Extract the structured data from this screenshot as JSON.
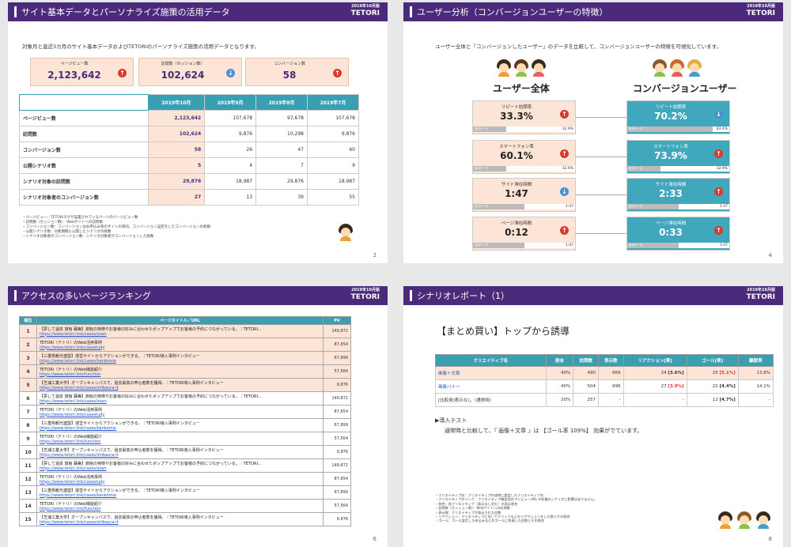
{
  "s1": {
    "title": "サイト基本データとパーソナライズ施策の活用データ",
    "date": "2019年10月版",
    "logo": "TETORI",
    "page": "2",
    "intro": "対象月と直近3カ月のサイト基本データおよびTETORIのパーソナライズ施策の活用データとなります。",
    "kpis": [
      {
        "label": "ページビュー数",
        "value": "2,123,642",
        "dir": "up"
      },
      {
        "label": "訪問数（セッション数）",
        "value": "102,624",
        "dir": "down"
      },
      {
        "label": "コンバージョン数",
        "value": "58",
        "dir": "up"
      }
    ],
    "cols": [
      "",
      "2019年10月",
      "2019年9月",
      "2019年8月",
      "2019年7月"
    ],
    "rows": [
      [
        "ページビュー数",
        "2,123,642",
        "107,678",
        "97,678",
        "107,678"
      ],
      [
        "訪問数",
        "102,624",
        "9,876",
        "10,298",
        "9,876"
      ],
      [
        "コンバージョン数",
        "58",
        "26",
        "47",
        "60"
      ],
      [
        "公開シナリオ数",
        "5",
        "4",
        "7",
        "9"
      ],
      [
        "シナリオ対象の訪問数",
        "29,876",
        "18,987",
        "29,876",
        "18,987"
      ],
      [
        "シナリオ対象者のコンバージョン数",
        "27",
        "13",
        "39",
        "55"
      ]
    ],
    "notes": [
      "・ページビュー：TETORIタグが設置されているページのページビュー数",
      "・訪問数（セッション数）：Webサイトへの訪問数",
      "・コンバージョン数：コンバージョンはお申込み等のサイトの目的。コンバージョン設定をしたコンバージョンの総数",
      "・公開シナリオ数：対象期間に公開したシナリオの総数",
      "・シナリオ対象者のコンバージョン数：シナリオ対象者がコンバージョンした総数"
    ]
  },
  "s2": {
    "title": "ユーザー分析（コンバージョンユーザーの特徴）",
    "date": "2019年10月版",
    "logo": "TETORI",
    "page": "4",
    "intro": "ユーザー全体と「コンバージョンしたユーザー」のデータを比較して、コンバージョンユーザーの特徴を可視化しています。",
    "left_title": "ユーザー全体",
    "right_title": "コンバージョンユーザー",
    "bar_label": "前月データ",
    "metrics": [
      {
        "label": "リピート訪問率",
        "left": "33.3%",
        "ldir": "up",
        "lprev": "32.9%",
        "lfill": 0.329,
        "right": "70.2%",
        "rdir": "down",
        "rprev": "83.4%",
        "rfill": 0.834
      },
      {
        "label": "スマートフォン率",
        "left": "60.1%",
        "ldir": "up",
        "lprev": "32.9%",
        "lfill": 0.329,
        "right": "73.9%",
        "rdir": "up",
        "rprev": "32.9%",
        "rfill": 0.329
      },
      {
        "label": "サイト滞在時間",
        "left": "1:47",
        "ldir": "down",
        "lprev": "1:47",
        "lfill": 0.5,
        "right": "2:33",
        "rdir": "up",
        "rprev": "1:47",
        "rfill": 0.5
      },
      {
        "label": "ページ滞在時間",
        "left": "0:12",
        "ldir": "up",
        "lprev": "1:47",
        "lfill": 0.5,
        "right": "0:33",
        "rdir": "up",
        "rprev": "1:47",
        "rfill": 0.5
      }
    ]
  },
  "s3": {
    "title": "アクセスの多いページランキング",
    "date": "2019年10月版",
    "logo": "TETORI",
    "page": "6",
    "cols": [
      "順位",
      "ページタイトル／URL",
      "PV"
    ],
    "rows": [
      {
        "rank": "1",
        "title": "【夢して温泉 旅館 蘇庵】旅館の特徴やお客様の好みに合わせたポップアップでお客様の予約につながっている。｜TETORI…",
        "url": "https://www.tetori.link/cases/soan",
        "pv": "149,872"
      },
      {
        "rank": "2",
        "title": "TETORI（テトリ）のWeb活用事例",
        "url": "https://www.tetori.link/casestudy",
        "pv": "87,654"
      },
      {
        "rank": "3",
        "title": "【三重県観光連盟】運営サイトからアクションができる。｜TETORI導入事例インタビュー",
        "url": "https://www.tetori.link/cases/kankomie",
        "pv": "67,899"
      },
      {
        "rank": "4",
        "title": "TETORI（テトリ）のWeb機能紹介",
        "url": "https://www.tetori.link/function",
        "pv": "57,564"
      },
      {
        "rank": "5",
        "title": "【芝浦工業大学】オープンキャンパスで、過去最高の申込者数を獲得。｜TETORI導入事例インタビュー",
        "url": "https://www.tetori.link/cases/shibaura-it",
        "pv": "9,876"
      },
      {
        "rank": "6",
        "title": "【夢して温泉 旅館 蘇庵】旅館の特徴やお客様の好みに合わせたポップアップでお客様の予約につながっている。｜TETORI…",
        "url": "https://www.tetori.link/cases/soan",
        "pv": "149,872"
      },
      {
        "rank": "7",
        "title": "TETORI（テトリ）のWeb活用事例",
        "url": "https://www.tetori.link/casestudy",
        "pv": "87,654"
      },
      {
        "rank": "8",
        "title": "【三重県観光連盟】運営サイトからアクションができる。｜TETORI導入事例インタビュー",
        "url": "https://www.tetori.link/cases/kankomie",
        "pv": "67,899"
      },
      {
        "rank": "9",
        "title": "TETORI（テトリ）のWeb機能紹介",
        "url": "https://www.tetori.link/function",
        "pv": "57,564"
      },
      {
        "rank": "10",
        "title": "【芝浦工業大学】オープンキャンパスで、過去最高の申込者数を獲得。｜TETORI導入事例インタビュー",
        "url": "https://www.tetori.link/cases/shibaura-it",
        "pv": "9,876"
      },
      {
        "rank": "11",
        "title": "【夢して温泉 旅館 蘇庵】旅館の特徴やお客様の好みに合わせたポップアップでお客様の予約につながっている。｜TETORI…",
        "url": "https://www.tetori.link/cases/soan",
        "pv": "149,872"
      },
      {
        "rank": "12",
        "title": "TETORI（テトリ）のWeb活用事例",
        "url": "https://www.tetori.link/casestudy",
        "pv": "87,654"
      },
      {
        "rank": "13",
        "title": "【三重県観光連盟】運営サイトからアクションができる。｜TETORI導入事例インタビュー",
        "url": "https://www.tetori.link/cases/kankomie",
        "pv": "67,899"
      },
      {
        "rank": "14",
        "title": "TETORI（テトリ）のWeb機能紹介",
        "url": "https://www.tetori.link/function",
        "pv": "57,564"
      },
      {
        "rank": "15",
        "title": "【芝浦工業大学】オープンキャンパスで、過去最高の申込者数を獲得。｜TETORI導入事例インタビュー",
        "url": "https://www.tetori.link/cases/shibaura-it",
        "pv": "9,876"
      }
    ]
  },
  "s4": {
    "title": "シナリオレポート（1）",
    "date": "2019年10月版",
    "logo": "TETORI",
    "page": "8",
    "heading": "【まとめ買い】トップから誘導",
    "cols": [
      "クリエイティブ名",
      "割合",
      "訪問数",
      "表示数",
      "リアクション[率]",
      "ゴール[率]",
      "離脱率"
    ],
    "rows": [
      {
        "name": "画像＋文章",
        "link": true,
        "ratio": "40%",
        "visits": "490",
        "views": "669",
        "react": "24",
        "react_rate": "[3.6%]",
        "goal": "25",
        "goal_rate": "[5.1%]",
        "goal_red": true,
        "exit": "13.8%"
      },
      {
        "name": "画像バナー",
        "link": true,
        "ratio": "40%",
        "visits": "504",
        "views": "696",
        "react": "27",
        "react_rate": "[3.9%]",
        "goal": "22",
        "goal_rate": "[4.4%]",
        "goal_red": false,
        "exit": "14.1%"
      },
      {
        "name": "[比較用]表示なし（通常時）",
        "link": false,
        "ratio": "20%",
        "visits": "257",
        "views": "-",
        "react": "-",
        "react_rate": "",
        "goal": "12",
        "goal_rate": "[4.7%]",
        "goal_red": false,
        "exit": "-"
      }
    ],
    "test_label": "▶導入テスト",
    "test_pre": "通常時と比較して、『 画像＋文章 』は 【ゴール率 109%】 効果がでています。",
    "notes": [
      "・クリエイティブ名：クリエイティブ作成時に設定したクリエイティブ名",
      "・クリエイティブのリンク：クリエイティブ確認用のプレビューURL ※本番のシナリオに影響はありません。",
      "・割合：各クリエイティブ（表示なし含む）の表示割合",
      "・訪問数（セッション数）：Webサイトへの訪問数",
      "・表示数：クリエイティブが表示された回数",
      "・リアクション：クリエイティブに対してクリックなどのリアクションをした数とその割合",
      "・ゴール：ゴール設定した申込みなどのゴールに到達した回数とその割合"
    ]
  }
}
